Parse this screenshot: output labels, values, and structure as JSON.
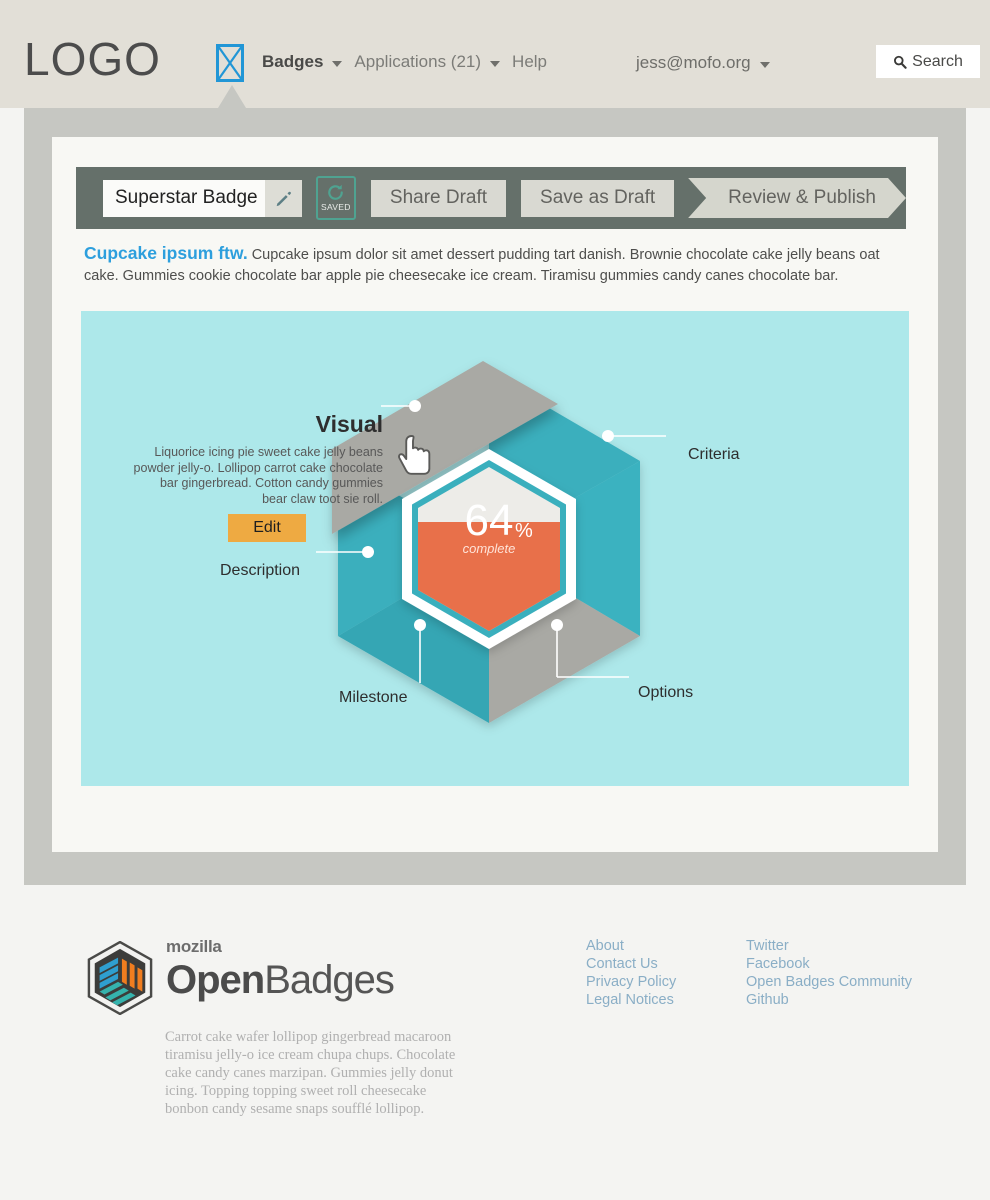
{
  "nav": {
    "logo_text": "LOGO",
    "mark_icon": "placeholder-image-icon",
    "items": [
      {
        "label": "Badges",
        "icon": "chevron-down-icon",
        "active": true
      },
      {
        "label": "Applications (21)",
        "icon": "chevron-down-icon",
        "active": false
      },
      {
        "label": "Help",
        "icon": "",
        "active": false
      }
    ],
    "user": {
      "label": "jess@mofo.org",
      "icon": "chevron-down-icon"
    },
    "search": {
      "label": "Search",
      "icon": "search-icon"
    }
  },
  "toolbar": {
    "badge_title": "Superstar Badge",
    "edit_icon": "pencil-icon",
    "saved": {
      "icon": "refresh-icon",
      "label": "SAVED"
    },
    "share_draft_label": "Share Draft",
    "save_as_draft_label": "Save as Draft",
    "review_publish_label": "Review & Publish"
  },
  "intro": {
    "lede": "Cupcake ipsum ftw.",
    "body": "Cupcake ipsum dolor sit amet dessert pudding tart danish. Brownie chocolate cake jelly beans oat cake. Gummies cookie chocolate bar apple pie cheesecake ice cream. Tiramisu gummies candy canes chocolate bar."
  },
  "infographic": {
    "percent": "64",
    "percent_sign": "%",
    "percent_caption": "complete",
    "cursor_icon": "pointing-hand-cursor-icon",
    "visual": {
      "title": "Visual",
      "body": "Liquorice icing pie sweet cake jelly beans powder jelly-o. Lollipop carrot cake chocolate bar gingerbread. Cotton candy gummies bear claw toot sie roll.",
      "edit_label": "Edit"
    },
    "labels": {
      "criteria": "Criteria",
      "description": "Description",
      "milestone": "Milestone",
      "options": "Options"
    }
  },
  "footer": {
    "brand_top": "mozilla",
    "brand_bold": "Open",
    "brand_light": "Badges",
    "logo_icon": "open-badges-hexagon-logo-icon",
    "copy": "Carrot cake wafer lollipop gingerbread macaroon tiramisu jelly-o ice cream chupa chups. Chocolate cake candy canes marzipan. Gummies jelly donut icing. Topping topping sweet roll cheesecake bonbon candy sesame snaps soufflé lollipop.",
    "links_col1": [
      "About",
      "Contact Us",
      "Privacy Policy",
      "Legal Notices"
    ],
    "links_col2": [
      "Twitter",
      "Facebook",
      "Open Badges Community",
      "Github"
    ]
  },
  "colors": {
    "nav_bg": "#e2dfd7",
    "band": "#c6c7c2",
    "panel": "#f8f8f4",
    "toolbar": "#65706a",
    "accent_blue": "#2d9fdd",
    "teal": "#3aafbd",
    "gray_face": "#a9a9a4",
    "orange": "#e8704a",
    "edit_orange": "#eeaa42",
    "info_bg": "#ade8ea",
    "saved_green": "#4fa391",
    "link": "#8aaec6"
  }
}
